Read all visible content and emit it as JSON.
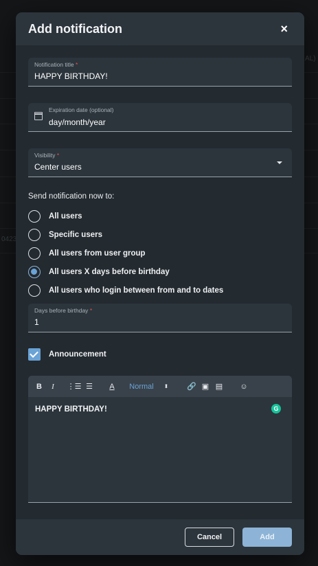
{
  "background": {
    "fragment_right": "AL)",
    "fragment_left": "0423"
  },
  "modal": {
    "title": "Add notification",
    "close_label": "×",
    "fields": {
      "title": {
        "label": "Notification title",
        "required": "*",
        "value": "HAPPY BIRTHDAY!"
      },
      "expiration": {
        "label": "Expiration date (optional)",
        "value": "day/month/year"
      },
      "visibility": {
        "label": "Visibility",
        "required": "*",
        "value": "Center users"
      }
    },
    "send_section_label": "Send notification now to:",
    "radio_options": [
      {
        "label": "All users",
        "checked": false
      },
      {
        "label": "Specific users",
        "checked": false
      },
      {
        "label": "All users from user group",
        "checked": false
      },
      {
        "label": "All users X days before birthday",
        "checked": true
      },
      {
        "label": "All users who login between from and to dates",
        "checked": false
      }
    ],
    "days_field": {
      "label": "Days before birthday",
      "required": "*",
      "value": "1"
    },
    "announcement": {
      "label": "Announcement",
      "checked": true
    },
    "editor": {
      "toolbar": {
        "bold": "B",
        "italic": "I",
        "ordered_list": "⋮☰",
        "bullet_list": "☰",
        "text_color": "A",
        "size": "Normal",
        "size_toggle": "⬍",
        "link": "🔗",
        "image": "▣",
        "video": "▤",
        "emoji": "☺"
      },
      "content": "HAPPY BIRTHDAY!",
      "grammarly_badge": "G"
    },
    "footer": {
      "cancel_label": "Cancel",
      "add_label": "Add"
    }
  },
  "colors": {
    "accent": "#6aa3d6",
    "modal_bg": "#232a30",
    "required": "#e25555"
  }
}
